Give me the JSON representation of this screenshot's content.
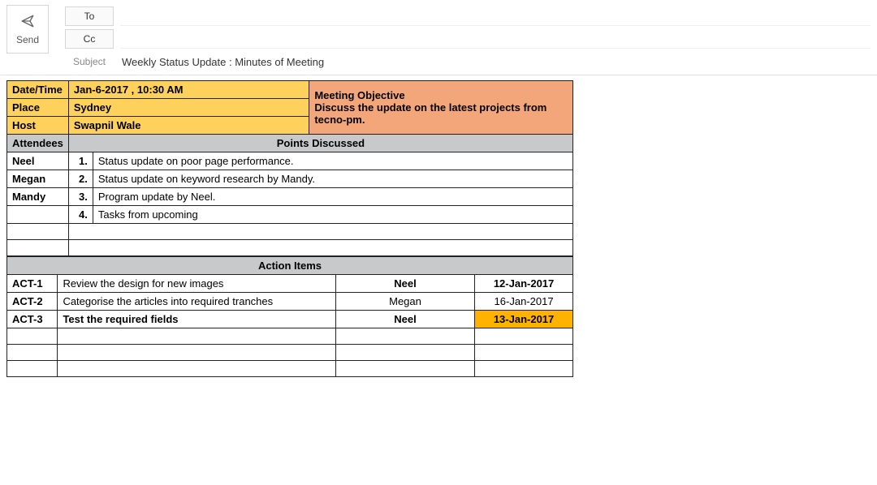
{
  "compose": {
    "to_label": "To",
    "cc_label": "Cc",
    "subject_label": "Subject",
    "subject_value": "Weekly Status Update : Minutes of Meeting",
    "send_label": "Send"
  },
  "meta": {
    "datetime_label": "Date/Time",
    "datetime_value": "Jan-6-2017 , 10:30 AM",
    "place_label": "Place",
    "place_value": "Sydney",
    "host_label": "Host",
    "host_value": "Swapnil Wale",
    "objective_label": "Meeting Objective",
    "objective_text": "Discuss the update on the latest projects from tecno-pm."
  },
  "discussion": {
    "attendees_header": "Attendees",
    "points_header": "Points Discussed",
    "attendees": [
      "Neel",
      "Megan",
      "Mandy"
    ],
    "points": [
      {
        "num": "1.",
        "text": "Status update on poor page performance."
      },
      {
        "num": "2.",
        "text": "Status update on keyword research by Mandy."
      },
      {
        "num": "3.",
        "text": "Program update by Neel."
      },
      {
        "num": "4.",
        "text": "Tasks from upcoming"
      }
    ]
  },
  "actions": {
    "header": "Action Items",
    "rows": [
      {
        "id": "ACT-1",
        "task": "Review the design for new images",
        "who": "Neel",
        "when": "12-Jan-2017",
        "hot": false
      },
      {
        "id": "ACT-2",
        "task": "Categorise the articles into required tranches",
        "who": "Megan",
        "when": "16-Jan-2017",
        "hot": false
      },
      {
        "id": "ACT-3",
        "task": "Test the required fields",
        "who": "Neel",
        "when": "13-Jan-2017",
        "hot": true,
        "bold": true
      }
    ]
  }
}
